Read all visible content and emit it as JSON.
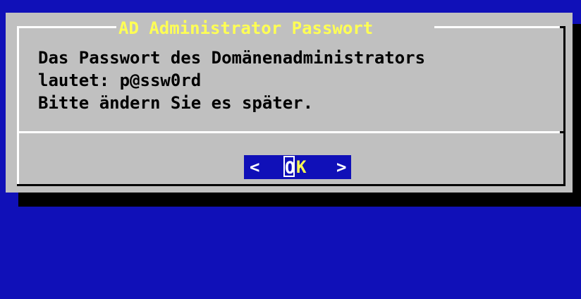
{
  "dialog": {
    "title": "AD Administrator Passwort",
    "message": "Das Passwort des Domänenadministrators\nlautet: p@ssw0rd\nBitte ändern Sie es später."
  },
  "button": {
    "left_bracket": "<",
    "hotkey": "O",
    "label_rest": "K",
    "right_bracket": ">"
  },
  "colors": {
    "background": "#1010b8",
    "dialog": "#c0c0c0",
    "title": "#ffff54",
    "text": "#000000",
    "button_background": "#1010b8",
    "button_text": "#ffffff",
    "button_hotkey": "#ffff54"
  },
  "icons": {}
}
